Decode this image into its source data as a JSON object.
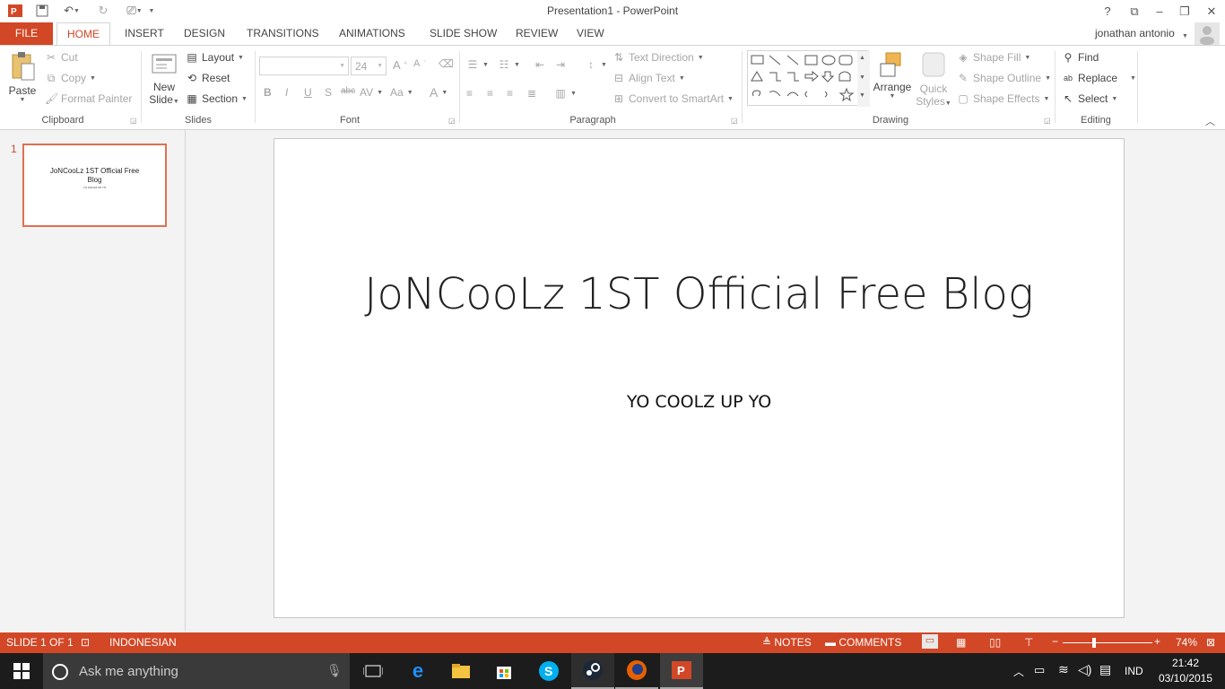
{
  "title_bar": {
    "title": "Presentation1 - PowerPoint",
    "help": "?",
    "user_name": "jonathan antonio"
  },
  "tabs": [
    "FILE",
    "HOME",
    "INSERT",
    "DESIGN",
    "TRANSITIONS",
    "ANIMATIONS",
    "SLIDE SHOW",
    "REVIEW",
    "VIEW"
  ],
  "active_tab": "HOME",
  "ribbon": {
    "clipboard": {
      "paste": "Paste",
      "cut": "Cut",
      "copy": "Copy",
      "format_painter": "Format Painter",
      "label": "Clipboard"
    },
    "slides": {
      "new_slide_line1": "New",
      "new_slide_line2": "Slide",
      "layout": "Layout",
      "reset": "Reset",
      "section": "Section",
      "label": "Slides"
    },
    "font": {
      "font_size": "24",
      "bold": "B",
      "italic": "I",
      "underline": "U",
      "shadow": "S",
      "strike": "abc",
      "spacing": "AV",
      "case": "Aa",
      "color": "A",
      "label": "Font"
    },
    "paragraph": {
      "text_direction": "Text Direction",
      "align_text": "Align Text",
      "convert_smartart": "Convert to SmartArt",
      "label": "Paragraph"
    },
    "drawing": {
      "arrange": "Arrange",
      "quick_styles_line1": "Quick",
      "quick_styles_line2": "Styles",
      "shape_fill": "Shape Fill",
      "shape_outline": "Shape Outline",
      "shape_effects": "Shape Effects",
      "label": "Drawing"
    },
    "editing": {
      "find": "Find",
      "replace": "Replace",
      "select": "Select",
      "label": "Editing"
    }
  },
  "slides_pane": {
    "slide_number": "1",
    "thumb_title": "JoNCooLz 1ST Official Free Blog",
    "thumb_subtitle": "YO COOLZ UP YO"
  },
  "slide": {
    "title": "JoNCooLz 1ST Official Free Blog",
    "subtitle": "YO COOLZ UP YO"
  },
  "status_bar": {
    "slide_info": "SLIDE 1 OF 1",
    "language": "INDONESIAN",
    "notes": "NOTES",
    "comments": "COMMENTS",
    "zoom": "74%",
    "zoom_level": 0.74
  },
  "taskbar": {
    "search_placeholder": "Ask me anything",
    "language": "IND",
    "time": "21:42",
    "date": "03/10/2015"
  },
  "colors": {
    "accent": "#d24726",
    "taskbar": "#1c1c1c"
  }
}
